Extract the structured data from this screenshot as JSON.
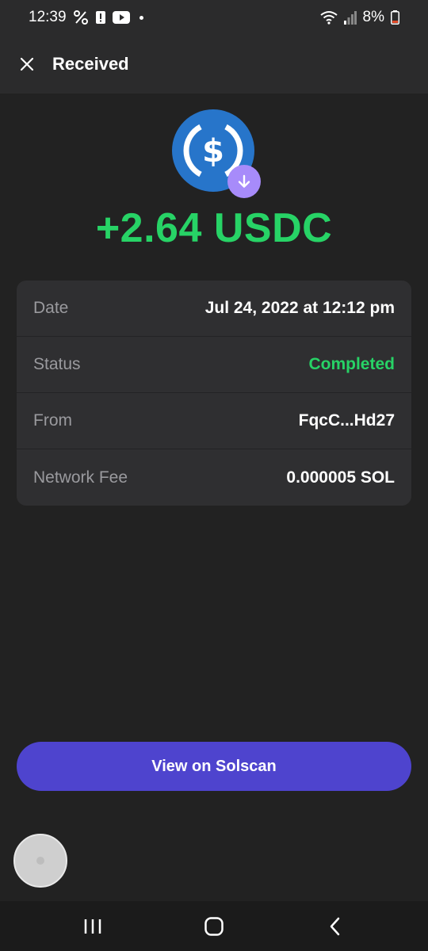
{
  "status_bar": {
    "time": "12:39",
    "battery": "8%",
    "icons": [
      "percent-icon",
      "alert-icon",
      "youtube-icon",
      "wifi-icon",
      "signal-icon",
      "battery-icon"
    ]
  },
  "header": {
    "title": "Received",
    "close_icon": "close-icon"
  },
  "transaction": {
    "token_icon": "usdc-icon",
    "badge_icon": "arrow-down-icon",
    "amount": "+2.64 USDC",
    "amount_color": "#27d366"
  },
  "details": [
    {
      "label": "Date",
      "value": "Jul 24, 2022 at 12:12 pm"
    },
    {
      "label": "Status",
      "value": "Completed"
    },
    {
      "label": "From",
      "value": "FqcC...Hd27"
    },
    {
      "label": "Network Fee",
      "value": "0.000005 SOL"
    }
  ],
  "actions": {
    "view_solscan": "View on Solscan"
  },
  "nav": {
    "icons": [
      "recents-icon",
      "home-icon",
      "back-icon"
    ]
  },
  "colors": {
    "accent": "#4e44ce",
    "success": "#27d366",
    "usdc_blue": "#2775ca",
    "badge": "#a78bfa"
  }
}
